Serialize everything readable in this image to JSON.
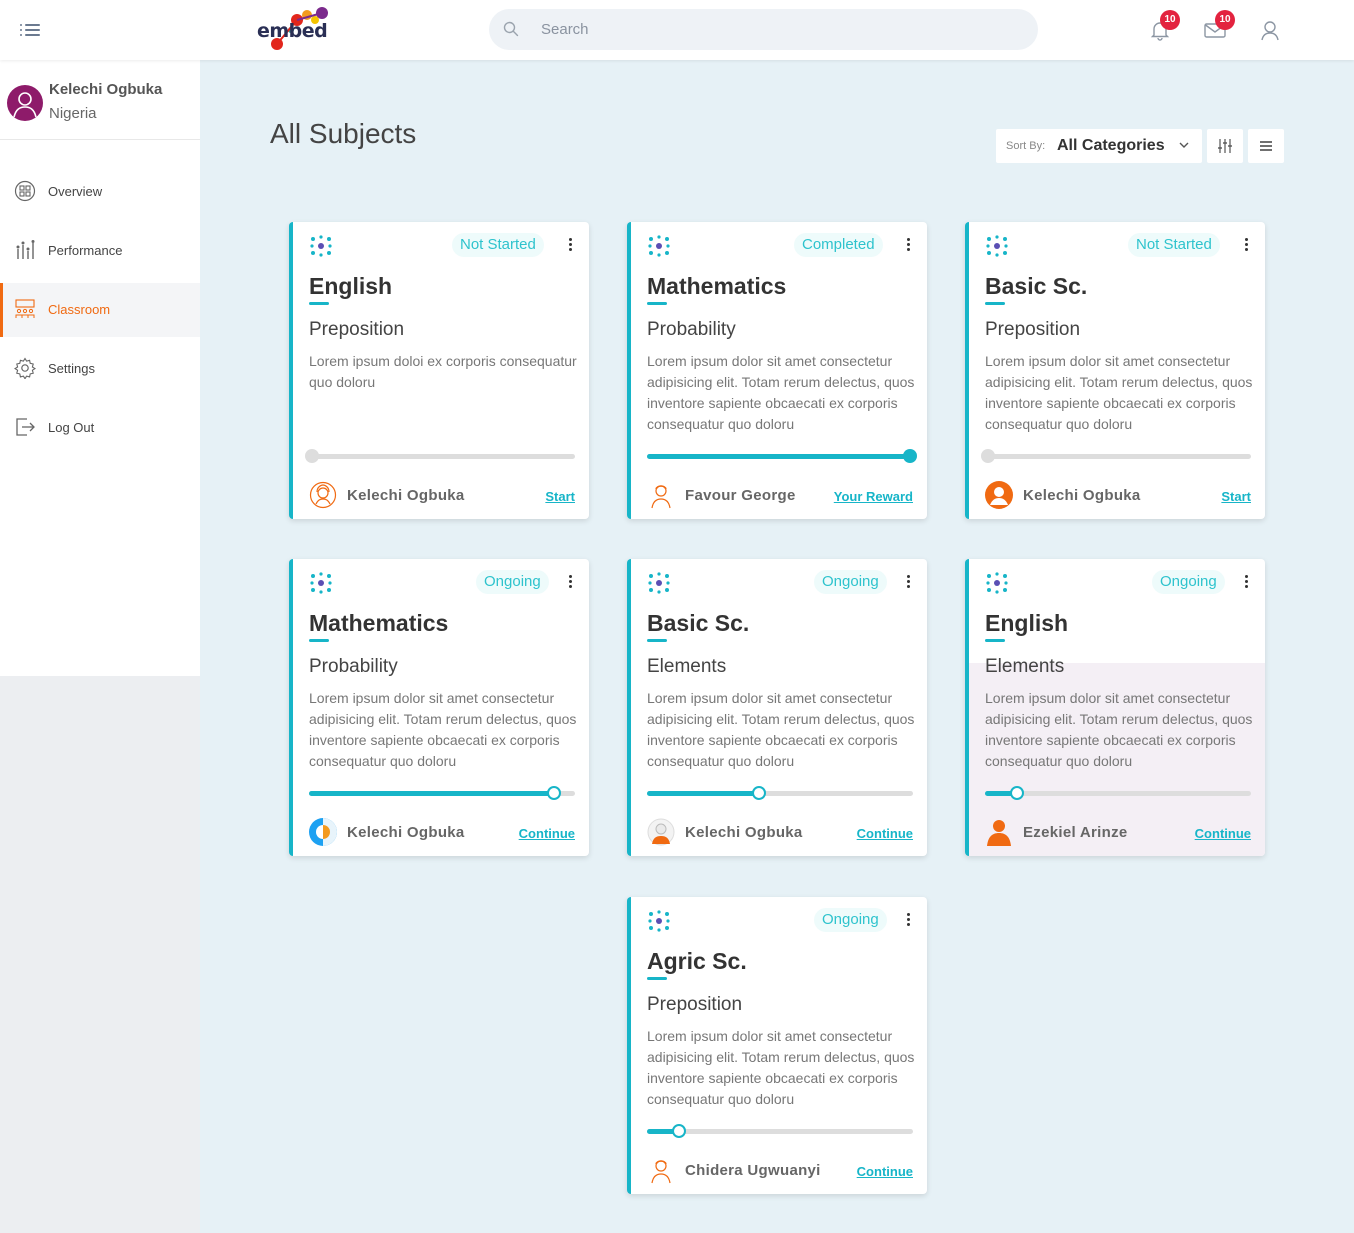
{
  "header": {
    "logo_text": "embed",
    "search_placeholder": "Search",
    "notifications_count": "10",
    "messages_count": "10"
  },
  "sidebar": {
    "user_name": "Kelechi Ogbuka",
    "user_country": "Nigeria",
    "items": [
      {
        "label": "Overview",
        "icon": "overview-icon"
      },
      {
        "label": "Performance",
        "icon": "performance-icon"
      },
      {
        "label": "Classroom",
        "icon": "classroom-icon",
        "active": true
      },
      {
        "label": "Settings",
        "icon": "gear-icon"
      },
      {
        "label": "Log Out",
        "icon": "logout-icon"
      }
    ]
  },
  "main": {
    "title": "All Subjects",
    "sort_label": "Sort By:",
    "sort_value": "All Categories"
  },
  "colors": {
    "accent": "#17b5c8",
    "active_nav": "#f06a12",
    "badge": "#e3233f"
  },
  "cards": [
    {
      "status": "Not Started",
      "subject": "English",
      "topic": "Preposition",
      "description": "Lorem ipsum doloi ex corporis consequatur quo doloru",
      "progress": 0,
      "person": "Kelechi Ogbuka",
      "action": "Start"
    },
    {
      "status": "Completed",
      "subject": "Mathematics",
      "topic": "Probability",
      "description": "Lorem ipsum dolor sit amet consectetur adipisicing elit. Totam rerum delectus, quos inventore sapiente obcaecati ex corporis consequatur quo doloru",
      "progress": 100,
      "person": "Favour George",
      "action": "Your Reward"
    },
    {
      "status": "Not Started",
      "subject": "Basic Sc.",
      "topic": "Preposition",
      "description": "Lorem ipsum dolor sit amet consectetur adipisicing elit. Totam rerum delectus, quos inventore sapiente obcaecati ex corporis consequatur quo doloru",
      "progress": 0,
      "person": "Kelechi Ogbuka",
      "action": "Start"
    },
    {
      "status": "Ongoing",
      "subject": "Mathematics",
      "topic": "Probability",
      "description": "Lorem ipsum dolor sit amet consectetur adipisicing elit. Totam rerum delectus, quos inventore sapiente obcaecati ex corporis consequatur quo doloru",
      "progress": 92,
      "person": "Kelechi Ogbuka",
      "action": "Continue"
    },
    {
      "status": "Ongoing",
      "subject": "Basic Sc.",
      "topic": "Elements",
      "description": "Lorem ipsum dolor sit amet consectetur adipisicing elit. Totam rerum delectus, quos inventore sapiente obcaecati ex corporis consequatur quo doloru",
      "progress": 42,
      "person": "Kelechi Ogbuka",
      "action": "Continue"
    },
    {
      "status": "Ongoing",
      "subject": "English",
      "topic": "Elements",
      "description": "Lorem ipsum dolor sit amet consectetur adipisicing elit. Totam rerum delectus, quos inventore sapiente obcaecati ex corporis consequatur quo doloru",
      "progress": 12,
      "person": "Ezekiel Arinze",
      "action": "Continue"
    },
    {
      "status": "Ongoing",
      "subject": "Agric Sc.",
      "topic": "Preposition",
      "description": "Lorem ipsum dolor sit amet consectetur adipisicing elit. Totam rerum delectus, quos inventore sapiente obcaecati ex corporis consequatur quo doloru",
      "progress": 12,
      "person": "Chidera Ugwuanyi",
      "action": "Continue"
    }
  ]
}
